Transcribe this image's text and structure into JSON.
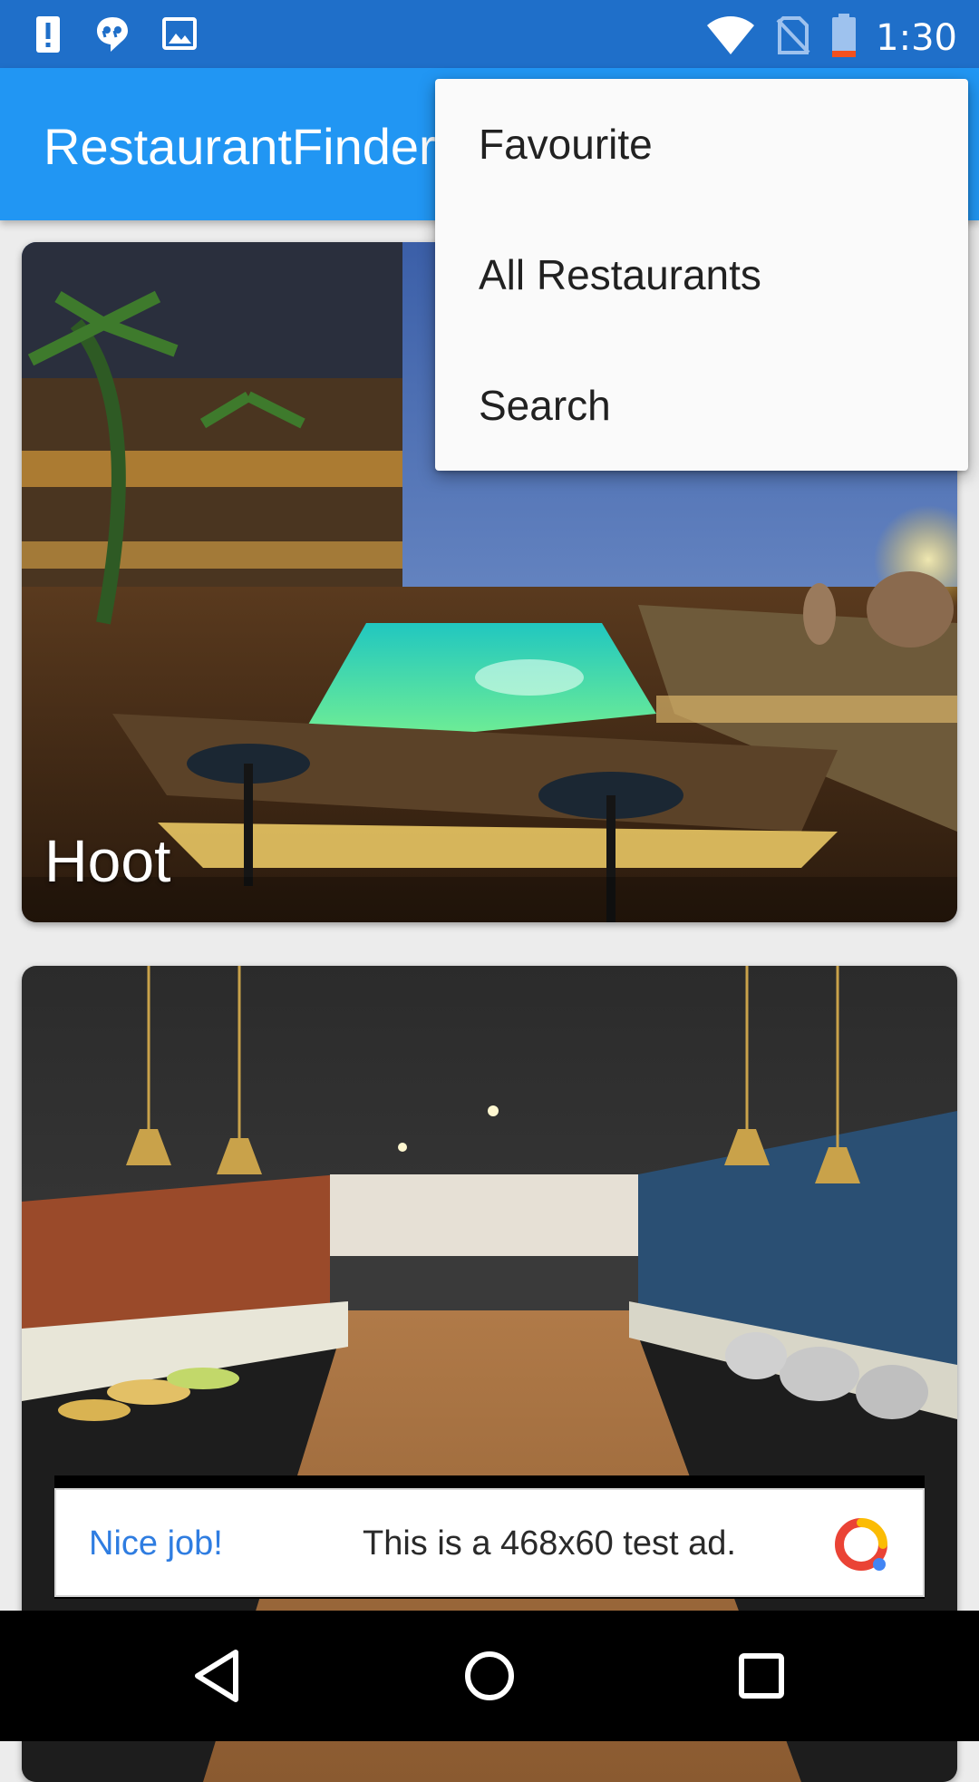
{
  "status_bar": {
    "time": "1:30",
    "color": "#1f6fc9",
    "left_icons": [
      "alert-icon",
      "chat-quote-icon",
      "image-icon"
    ],
    "right_icons": [
      "wifi-icon",
      "no-sim-icon",
      "battery-low-icon"
    ]
  },
  "app_bar": {
    "title": "RestaurantFinder",
    "color": "#2196f3"
  },
  "overflow_menu": {
    "items": [
      {
        "label": "Favourite"
      },
      {
        "label": "All Restaurants"
      },
      {
        "label": "Search"
      }
    ]
  },
  "restaurants": [
    {
      "name": "Hoot",
      "image": "poolside-restaurant-night-photo"
    },
    {
      "name": "",
      "image": "buffet-restaurant-interior-photo"
    }
  ],
  "ad": {
    "cta": "Nice job!",
    "text": "This is a 468x60 test ad.",
    "cta_color": "#2f7de1"
  },
  "nav_bar": {
    "buttons": [
      "back-icon",
      "home-icon",
      "recents-icon"
    ]
  }
}
